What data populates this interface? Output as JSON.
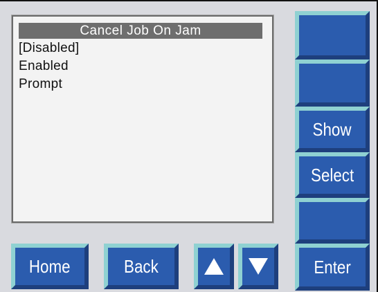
{
  "screen": {
    "title": "Cancel Job On Jam",
    "options": [
      "[Disabled]",
      "Enabled",
      "Prompt"
    ]
  },
  "side_buttons": {
    "button1": "",
    "button2": "",
    "show": "Show",
    "select": "Select",
    "button5": "",
    "enter": "Enter"
  },
  "bottom_buttons": {
    "home": "Home",
    "back": "Back",
    "up_icon": "up-arrow-icon",
    "down_icon": "down-arrow-icon"
  },
  "colors": {
    "button_face": "#2b5cae",
    "button_highlight": "#8fd1d2",
    "panel": "#d9dadf",
    "screen": "#f3f3f3",
    "title_bar": "#6e6e6e"
  }
}
